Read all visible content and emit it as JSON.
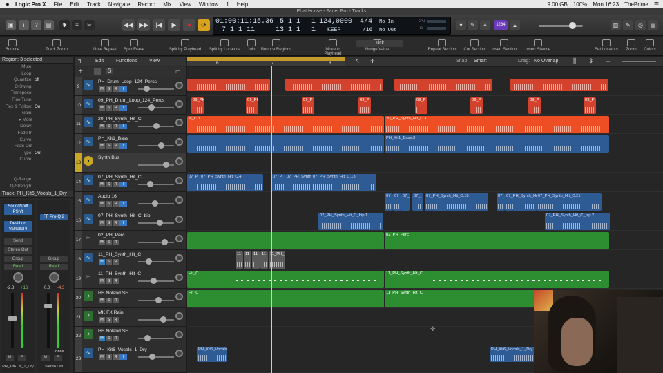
{
  "menubar": {
    "app_name": "Logic Pro X",
    "items": [
      "File",
      "Edit",
      "Track",
      "Navigate",
      "Record",
      "Mix",
      "View",
      "Window",
      "1",
      "Help"
    ],
    "status": {
      "storage": "9.00 GB",
      "battery": "100%",
      "day_time": "Mon 16:23",
      "user": "ThePrime"
    }
  },
  "window_title": "Phat House - Fader Pro - Tracks",
  "lcd": {
    "smpte": "01:00:11:15.36",
    "smpte_sub": "7  1  1     11",
    "bar_beat": "5  1  1",
    "bar_beat_sub": "13  1  1",
    "div": "1",
    "div_sub": "1",
    "tempo": "124,0000",
    "tempo_mode": "KEEP",
    "sig": "4/4",
    "sig_div": "/16",
    "in": "No In",
    "out": "No Out",
    "cpu_label": "CPU",
    "hd_label": "HD",
    "tuner": "1234"
  },
  "toolstrip": {
    "items": [
      "Bounce",
      "Track Zoom",
      "Note Repeat",
      "Spot Erase",
      "Split by Playhead",
      "Split by Locators",
      "Join",
      "Bounce Regions",
      "Move to Playhead",
      "Nudge Value",
      "Repeat Section",
      "Cut Section",
      "Insert Section",
      "Insert Silence",
      "Set Locators",
      "Zoom",
      "Colors"
    ],
    "nudge_value": "Tick"
  },
  "inspector": {
    "region_header": "Region: 3 selected",
    "rows": [
      {
        "k": "Mute:",
        "v": ""
      },
      {
        "k": "Loop:",
        "v": ""
      },
      {
        "k": "Quantize:",
        "v": "off"
      },
      {
        "k": "Q-Swing:",
        "v": ""
      },
      {
        "k": "Transpose:",
        "v": ""
      },
      {
        "k": "Fine Tune:",
        "v": ""
      },
      {
        "k": "Flex & Follow:",
        "v": "On"
      },
      {
        "k": "Gain:",
        "v": ""
      },
      {
        "k": "▸ More",
        "v": ""
      },
      {
        "k": "Delay:",
        "v": ""
      },
      {
        "k": "Fade In",
        "v": ""
      },
      {
        "k": "Curve:",
        "v": ""
      },
      {
        "k": "Fade Out",
        "v": ""
      },
      {
        "k": "Type:",
        "v": "Out"
      },
      {
        "k": "Curve:",
        "v": ""
      },
      {
        "k": "-",
        "v": ""
      },
      {
        "k": "-",
        "v": ""
      },
      {
        "k": "Q-Range:",
        "v": ""
      },
      {
        "k": "Q-Strength:",
        "v": ""
      }
    ],
    "track_header": "Track:  PH_Kit6_Vocals_1_Dry",
    "strip1": {
      "plugins": [
        "SoundShift PShft",
        "DeviiLoc ValhallaPl"
      ],
      "send": "Send",
      "output": "Stereo Out",
      "group": "Group",
      "read": "Read",
      "vol": "-2,8",
      "peak": "+16",
      "m": "M",
      "s": "S",
      "name": "PH_Kit6...ls_1_Dry"
    },
    "strip2": {
      "plugins": [
        "FF Pro-Q 2"
      ],
      "group": "Group",
      "read": "Read",
      "vol": "0,0",
      "peak": "-4,3",
      "bnce": "Bnce",
      "m": "M",
      "s": "S",
      "name": "Stereo Out"
    }
  },
  "track_header_bar": {
    "edit": "Edit",
    "functions": "Functions",
    "view": "View",
    "snap_label": "Snap:",
    "snap_value": "Smart",
    "drag_label": "Drag:",
    "drag_value": "No Overlap"
  },
  "tracks": [
    {
      "num": "9",
      "name": "PH_Drum_Loop_124_Percs",
      "icon": "waveform-icon",
      "btns": [
        "M",
        "S",
        "R",
        "I"
      ]
    },
    {
      "num": "10",
      "name": "09_PH_Drum_Loop_124_Percs",
      "icon": "waveform-icon",
      "btns": [
        "M",
        "S",
        "R",
        "I"
      ]
    },
    {
      "num": "11",
      "name": "20_PH_Synth_Hit_C",
      "icon": "waveform-icon",
      "btns": [
        "M",
        "S",
        "R",
        "I"
      ]
    },
    {
      "num": "12",
      "name": "PH_Kit1_Bass",
      "icon": "waveform-icon",
      "btns": [
        "M",
        "S",
        "R",
        "I"
      ]
    },
    {
      "num": "13",
      "name": "Synth Bus",
      "icon": "bus-icon",
      "btns": []
    },
    {
      "num": "14",
      "name": "07_PH_Synth_Hit_C",
      "icon": "waveform-icon",
      "btns": [
        "M",
        "S",
        "R",
        "I"
      ]
    },
    {
      "num": "15",
      "name": "Audio 16",
      "icon": "waveform-icon",
      "btns": [
        "M",
        "S",
        "R",
        "I"
      ]
    },
    {
      "num": "16",
      "name": "07_PH_Synth_Hit_C_bip",
      "icon": "waveform-icon",
      "btns": [
        "M",
        "S",
        "R",
        "I"
      ]
    },
    {
      "num": "17",
      "name": "02_PH_Perc",
      "icon": "scissors-icon",
      "btns": [
        "M",
        "S",
        "R"
      ]
    },
    {
      "num": "18",
      "name": "11_PH_Synth_Hit_C",
      "icon": "waveform-icon",
      "btns": [
        "M",
        "S",
        "R"
      ]
    },
    {
      "num": "19",
      "name": "11_PH_Synth_Hit_C",
      "icon": "scissors-icon",
      "btns": [
        "M",
        "S",
        "R"
      ]
    },
    {
      "num": "20",
      "name": "HS Noland SH",
      "icon": "note-icon",
      "btns": [
        "M",
        "S",
        "R"
      ]
    },
    {
      "num": "21",
      "name": "MK FX Rain",
      "icon": "note-icon",
      "btns": [
        "M",
        "S",
        "R"
      ]
    },
    {
      "num": "22",
      "name": "HS Noland SH",
      "icon": "note-icon",
      "btns": [
        "M",
        "S",
        "R"
      ]
    },
    {
      "num": "23",
      "name": "PH_Kit6_Vocals_1_Dry",
      "icon": "waveform-icon",
      "btns": [
        "M",
        "S",
        "R",
        "I"
      ]
    }
  ],
  "ruler": [
    "6",
    "7",
    "8",
    "9",
    "10",
    "11",
    "12",
    "13"
  ],
  "regions": {
    "r10": [
      "09_PH",
      "09_PH",
      "09_P",
      "09_P",
      "09_P",
      "09_P",
      "09_P",
      "09_P"
    ],
    "r11a": "el_C.1",
    "r11b": "20_PH_Synth_Hit_C.3",
    "r12": "PH_Kit1_Bass.3",
    "r14": [
      "07_P",
      "07_PH_Synth_Hit_C.4",
      "07_P",
      "07_PH_Synth_Hit",
      "07_PH_Synth_Hit_C.13"
    ],
    "r15": [
      "07",
      "07",
      "07_",
      "07_",
      "07_PH_Synth_Hit_C.18",
      "07",
      "07_PH_Synth_Hit",
      "07_PH_Synth_Hit_C.21"
    ],
    "r16": [
      "07_PH_Synth_Hit_C_bip.1",
      "07_PH_Synth_Hit_C_bip.2"
    ],
    "r17": [
      "02_PH_Perc"
    ],
    "r18": [
      "11",
      "11",
      "11",
      "11",
      "11_PH_"
    ],
    "r19": [
      "Hit_C",
      "11_PH_Synth_Hit_C"
    ],
    "r20": [
      "Hit_C",
      "11_PH_Synth_Hit_C"
    ],
    "r23": [
      "PH_Kit6_Vocals",
      "PH_Kit6_Vocals_1_Dry.7"
    ]
  },
  "colors": {
    "orange": "#ee4e24",
    "red": "#d2422c",
    "blue": "#2f5b94",
    "green": "#2d8d31",
    "ruler": "#c49a2b",
    "accent": "#2e7bbf"
  }
}
